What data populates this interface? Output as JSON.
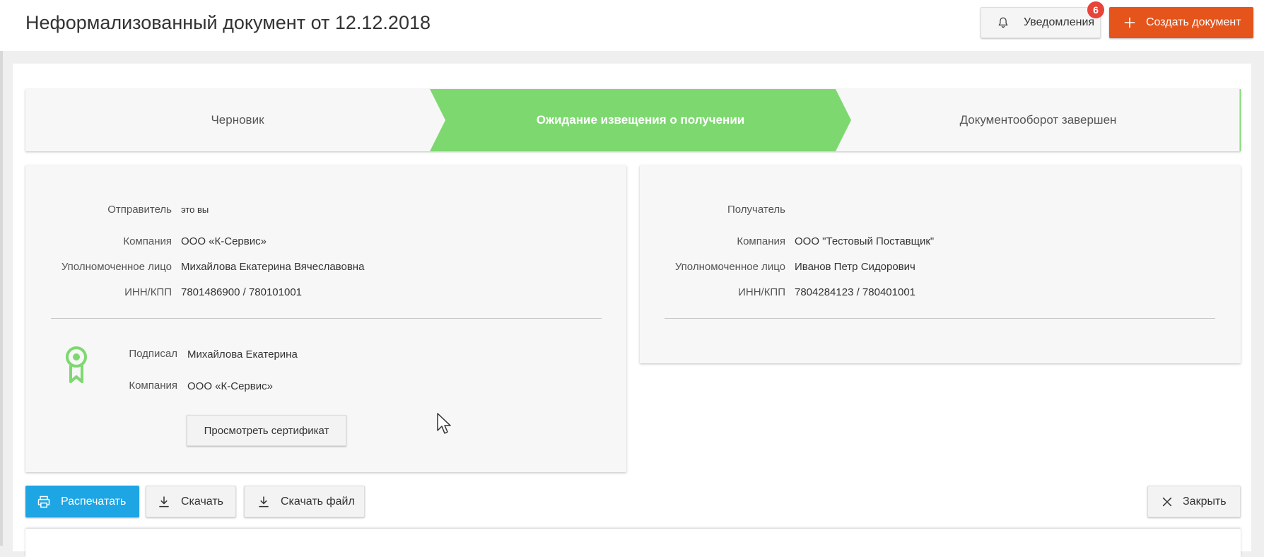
{
  "header": {
    "title": "Неформализованный документ от 12.12.2018",
    "notifications_label": "Уведомления",
    "notifications_count": "6",
    "create_label": "Создать документ",
    "accent_color": "#e5541b",
    "badge_color": "#e8443a"
  },
  "stepper": {
    "steps": [
      {
        "label": "Черновик",
        "state": "done"
      },
      {
        "label": "Ожидание извещения о получении",
        "state": "active"
      },
      {
        "label": "Документооборот завершен",
        "state": "pending"
      }
    ],
    "active_color": "#7dd96f"
  },
  "sender": {
    "title_label": "Отправитель",
    "title_note": "это вы",
    "company_label": "Компания",
    "company_value": "ООО «К-Сервис»",
    "person_label": "Уполномоченное лицо",
    "person_value": "Михайлова Екатерина Вячеславовна",
    "inn_label": "ИНН/КПП",
    "inn_value": "7801486900 / 780101001",
    "signature": {
      "icon": "certificate-ribbon-icon",
      "signed_label": "Подписал",
      "signed_value": "Михайлова Екатерина",
      "company_label": "Компания",
      "company_value": "ООО «К-Сервис»",
      "view_cert_label": "Просмотреть сертификат"
    }
  },
  "recipient": {
    "title_label": "Получатель",
    "company_label": "Компания",
    "company_value": "ООО \"Тестовый Поставщик\"",
    "person_label": "Уполномоченное лицо",
    "person_value": "Иванов Петр Сидорович",
    "inn_label": "ИНН/КПП",
    "inn_value": "7804284123 / 780401001"
  },
  "actions": {
    "print_label": "Распечатать",
    "download_label": "Скачать",
    "download_file_label": "Скачать файл",
    "close_label": "Закрыть",
    "print_color": "#1ea5e4"
  }
}
